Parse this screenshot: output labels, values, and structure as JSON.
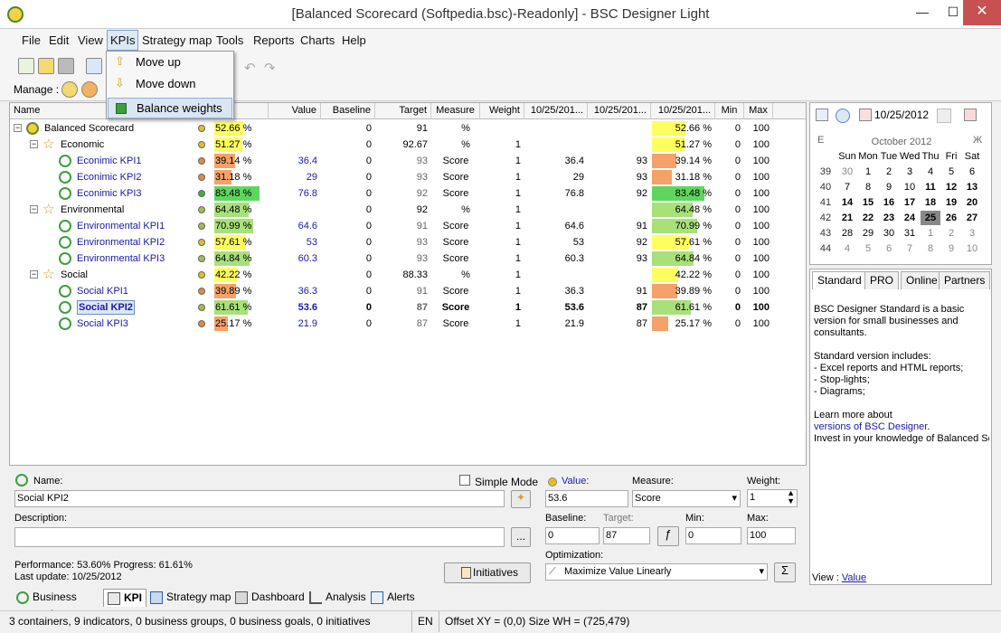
{
  "window": {
    "title": "[Balanced Scorecard (Softpedia.bsc)-Readonly] - BSC Designer Light",
    "min": "—",
    "max": "☐",
    "close": "✕"
  },
  "menu": [
    "File",
    "Edit",
    "View",
    "KPIs",
    "Strategy map",
    "Tools",
    "Reports",
    "Charts",
    "Help"
  ],
  "toolbar": {
    "manage_label": "Manage :"
  },
  "kpis_menu": {
    "items": [
      "Move up",
      "Move down",
      "Balance weights"
    ]
  },
  "grid": {
    "columns": [
      "Name",
      "Value",
      "Baseline",
      "Target",
      "Measure",
      "Weight",
      "10/25/201...",
      "10/25/201...",
      "10/25/201...",
      "Min",
      "Max"
    ],
    "rows": [
      {
        "name": "Balanced Scorecard",
        "level": 0,
        "perf": "52.66 %",
        "value": "",
        "baseline": "0",
        "target": "91",
        "measure": "%",
        "weight": "",
        "c1": "",
        "c2": "",
        "perf2": "52.66 %",
        "min": "0",
        "max": "100",
        "dot": "#e0c020",
        "pcolor": "#ffff60",
        "pw": 0.53,
        "p2w": 0.53
      },
      {
        "name": "Economic",
        "level": 1,
        "perf": "51.27 %",
        "value": "",
        "baseline": "0",
        "target": "92.67",
        "measure": "%",
        "weight": "1",
        "c1": "",
        "c2": "",
        "perf2": "51.27 %",
        "min": "0",
        "max": "100",
        "dot": "#e0c020",
        "pcolor": "#ffff60",
        "pw": 0.51,
        "p2w": 0.51
      },
      {
        "name": "Econimic KPI1",
        "level": 2,
        "perf": "39.14 %",
        "value": "36.4",
        "baseline": "0",
        "target": "93",
        "measure": "Score",
        "weight": "1",
        "c1": "36.4",
        "c2": "93",
        "perf2": "39.14 %",
        "min": "0",
        "max": "100",
        "dot": "#e08a40",
        "pcolor": "#f4a26a",
        "pw": 0.39,
        "p2w": 0.39
      },
      {
        "name": "Econimic KPI2",
        "level": 2,
        "perf": "31.18 %",
        "value": "29",
        "baseline": "0",
        "target": "93",
        "measure": "Score",
        "weight": "1",
        "c1": "29",
        "c2": "93",
        "perf2": "31.18 %",
        "min": "0",
        "max": "100",
        "dot": "#e08a40",
        "pcolor": "#f4a26a",
        "pw": 0.31,
        "p2w": 0.31
      },
      {
        "name": "Econimic KPI3",
        "level": 2,
        "perf": "83.48 %",
        "value": "76.8",
        "baseline": "0",
        "target": "92",
        "measure": "Score",
        "weight": "1",
        "c1": "76.8",
        "c2": "92",
        "perf2": "83.48 %",
        "min": "0",
        "max": "100",
        "dot": "#40b040",
        "pcolor": "#5ed65e",
        "pw": 0.83,
        "p2w": 0.83
      },
      {
        "name": "Environmental",
        "level": 1,
        "perf": "64.48 %",
        "value": "",
        "baseline": "0",
        "target": "92",
        "measure": "%",
        "weight": "1",
        "c1": "",
        "c2": "",
        "perf2": "64.48 %",
        "min": "0",
        "max": "100",
        "dot": "#a0c040",
        "pcolor": "#a8e07a",
        "pw": 0.64,
        "p2w": 0.64
      },
      {
        "name": "Environmental KPI1",
        "level": 2,
        "perf": "70.99 %",
        "value": "64.6",
        "baseline": "0",
        "target": "91",
        "measure": "Score",
        "weight": "1",
        "c1": "64.6",
        "c2": "91",
        "perf2": "70.99 %",
        "min": "0",
        "max": "100",
        "dot": "#a0c040",
        "pcolor": "#a8e07a",
        "pw": 0.71,
        "p2w": 0.71
      },
      {
        "name": "Environmental KPI2",
        "level": 2,
        "perf": "57.61 %",
        "value": "53",
        "baseline": "0",
        "target": "93",
        "measure": "Score",
        "weight": "1",
        "c1": "53",
        "c2": "92",
        "perf2": "57.61 %",
        "min": "0",
        "max": "100",
        "dot": "#e0c020",
        "pcolor": "#ffff60",
        "pw": 0.58,
        "p2w": 0.58
      },
      {
        "name": "Environmental KPI3",
        "level": 2,
        "perf": "64.84 %",
        "value": "60.3",
        "baseline": "0",
        "target": "93",
        "measure": "Score",
        "weight": "1",
        "c1": "60.3",
        "c2": "93",
        "perf2": "64.84 %",
        "min": "0",
        "max": "100",
        "dot": "#a0c040",
        "pcolor": "#a8e07a",
        "pw": 0.65,
        "p2w": 0.65
      },
      {
        "name": "Social",
        "level": 1,
        "perf": "42.22 %",
        "value": "",
        "baseline": "0",
        "target": "88.33",
        "measure": "%",
        "weight": "1",
        "c1": "",
        "c2": "",
        "perf2": "42.22 %",
        "min": "0",
        "max": "100",
        "dot": "#e0c020",
        "pcolor": "#ffff60",
        "pw": 0.42,
        "p2w": 0.42
      },
      {
        "name": "Social KPI1",
        "level": 2,
        "perf": "39.89 %",
        "value": "36.3",
        "baseline": "0",
        "target": "91",
        "measure": "Score",
        "weight": "1",
        "c1": "36.3",
        "c2": "91",
        "perf2": "39.89 %",
        "min": "0",
        "max": "100",
        "dot": "#e08a40",
        "pcolor": "#f4a26a",
        "pw": 0.4,
        "p2w": 0.4
      },
      {
        "name": "Social KPI2",
        "level": 2,
        "perf": "61.61 %",
        "value": "53.6",
        "baseline": "0",
        "target": "87",
        "measure": "Score",
        "weight": "1",
        "c1": "53.6",
        "c2": "87",
        "perf2": "61.61 %",
        "min": "0",
        "max": "100",
        "dot": "#a0c040",
        "pcolor": "#a8e07a",
        "pw": 0.62,
        "p2w": 0.62,
        "selected": true
      },
      {
        "name": "Social KPI3",
        "level": 2,
        "perf": "25.17 %",
        "value": "21.9",
        "baseline": "0",
        "target": "87",
        "measure": "Score",
        "weight": "1",
        "c1": "21.9",
        "c2": "87",
        "perf2": "25.17 %",
        "min": "0",
        "max": "100",
        "dot": "#e08a40",
        "pcolor": "#f4a26a",
        "pw": 0.25,
        "p2w": 0.25
      }
    ]
  },
  "calendar": {
    "date": "10/25/2012",
    "month": "October 2012",
    "prev": "E",
    "next": "Ж",
    "dows": [
      "Sun",
      "Mon",
      "Tue",
      "Wed",
      "Thu",
      "Fri",
      "Sat"
    ],
    "weeks": [
      "39",
      "40",
      "41",
      "42",
      "43",
      "44"
    ],
    "days": [
      [
        "30",
        "1",
        "2",
        "3",
        "4",
        "5",
        "6"
      ],
      [
        "7",
        "8",
        "9",
        "10",
        "11",
        "12",
        "13"
      ],
      [
        "14",
        "15",
        "16",
        "17",
        "18",
        "19",
        "20"
      ],
      [
        "21",
        "22",
        "23",
        "24",
        "25",
        "26",
        "27"
      ],
      [
        "28",
        "29",
        "30",
        "31",
        "1",
        "2",
        "3"
      ],
      [
        "4",
        "5",
        "6",
        "7",
        "8",
        "9",
        "10"
      ]
    ]
  },
  "info": {
    "tabs": [
      "Standard",
      "PRO",
      "Online",
      "Partners"
    ],
    "p1": "BSC Designer Standard is a basic version for small businesses and consultants.",
    "p2_title": "Standard version includes:",
    "b1": " - Excel reports and HTML reports;",
    "b2": " - Stop-lights;",
    "b3": " - Diagrams;",
    "p3": "Learn more about",
    "link": "versions of BSC Designer",
    "p3b": ".",
    "p4": "Invest in your knowledge of Balanced Sc",
    "view_label": "View :",
    "view_link": "Value"
  },
  "editor": {
    "name_label": "Name:",
    "name_value": "Social KPI2",
    "simple_mode": "Simple Mode",
    "description_label": "Description:",
    "description_value": "",
    "value_label": "Value:",
    "value": "53.6",
    "measure_label": "Measure:",
    "measure": "Score",
    "weight_label": "Weight:",
    "weight": "1",
    "baseline_label": "Baseline:",
    "baseline": "0",
    "target_label": "Target:",
    "target": "87",
    "min_label": "Min:",
    "min": "0",
    "max_label": "Max:",
    "max": "100",
    "optimization_label": "Optimization:",
    "optimization": "Maximize Value Linearly",
    "performance": "Performance: 53.60% Progress: 61.61%",
    "last_update": "Last update: 10/25/2012",
    "initiatives": "Initiatives",
    "dots": "..."
  },
  "bottom_tabs": [
    "Business goals",
    "KPI",
    "Strategy map",
    "Dashboard",
    "Analysis",
    "Alerts"
  ],
  "status": {
    "counts": "3 containers, 9 indicators, 0 business groups, 0 business goals, 0 initiatives",
    "lang": "EN",
    "offset": "Offset XY = (0,0) Size WH = (725,479)"
  }
}
